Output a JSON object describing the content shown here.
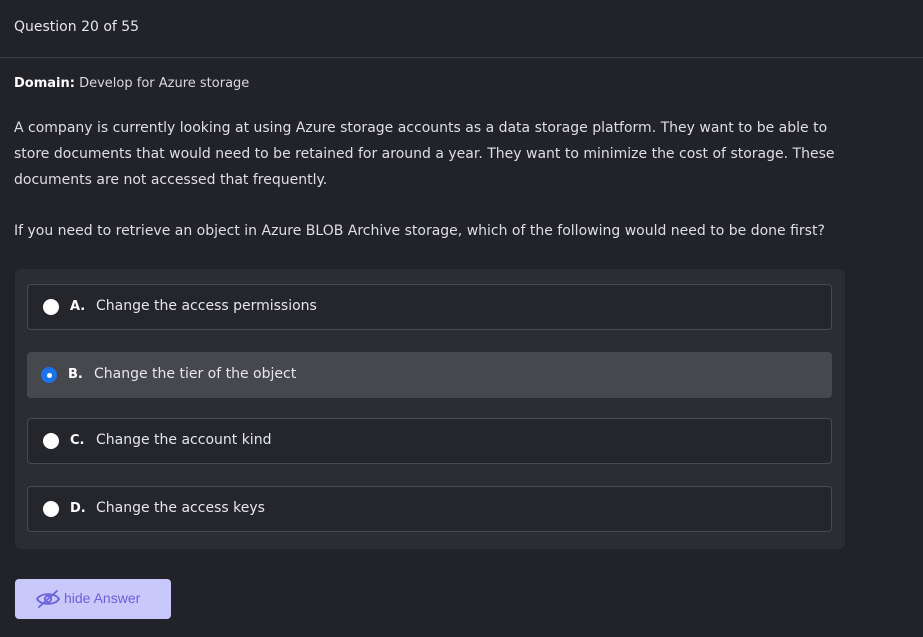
{
  "header": {
    "title": "Question 20 of 55"
  },
  "domain": {
    "label": "Domain:",
    "value": "Develop for Azure storage"
  },
  "question": {
    "scenario": "A company is currently looking at using Azure storage accounts as a data storage platform. They want to be able to store documents that would need to be retained for around a year. They want to minimize the cost of storage. These documents are not accessed that frequently.",
    "prompt": "If you need to retrieve an object in Azure BLOB Archive storage, which of the following would need to be done first?"
  },
  "options": [
    {
      "letter": "A.",
      "text": "Change the access permissions",
      "selected": false
    },
    {
      "letter": "B.",
      "text": "Change the tier of the object",
      "selected": true
    },
    {
      "letter": "C.",
      "text": "Change the account kind",
      "selected": false
    },
    {
      "letter": "D.",
      "text": "Change the access keys",
      "selected": false
    }
  ],
  "answer_button": {
    "label": "hide Answer",
    "icon": "eye-slash-icon"
  },
  "colors": {
    "background": "#222328",
    "panel": "#2c2d33",
    "selected_option": "#47484e",
    "radio_selected": "#1a73e8",
    "button_bg": "#c9c8fb",
    "button_text": "#6a62d8"
  }
}
